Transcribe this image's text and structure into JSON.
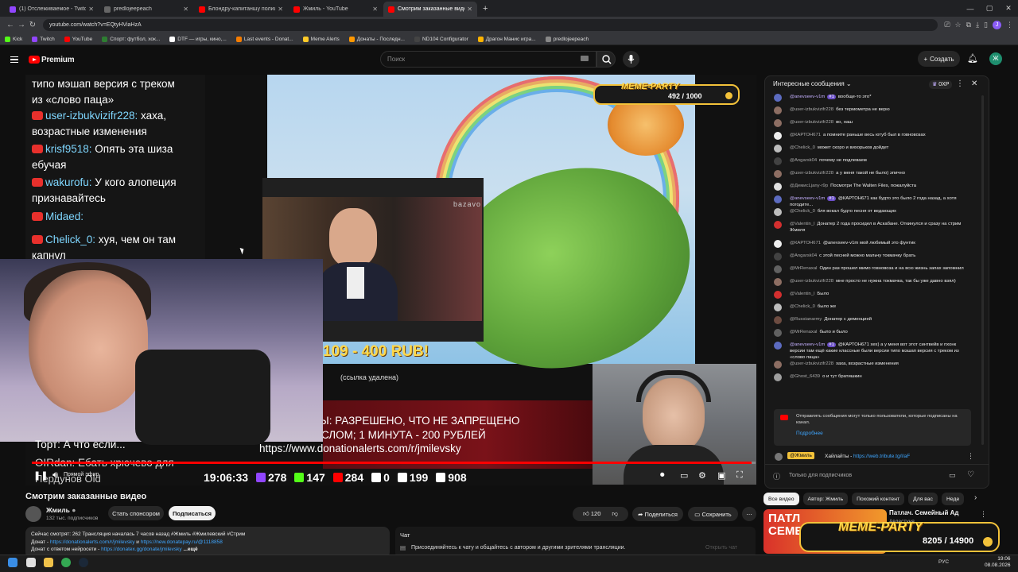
{
  "browser": {
    "tabs": [
      {
        "title": "(1) Отслеживаемое - Twitch",
        "color": "#9146ff"
      },
      {
        "title": "predlojeepeach",
        "color": "#666666"
      },
      {
        "title": "Блондру-капитаншу полиции",
        "color": "#ff0000"
      },
      {
        "title": "Жмиль - YouTube",
        "color": "#ff0000"
      },
      {
        "title": "Смотрим заказанные видео",
        "color": "#ff0000"
      }
    ],
    "address": "youtube.com/watch?v=EQtyHViaHzA",
    "bookmarks": [
      {
        "label": "Kick",
        "color": "#53fc18"
      },
      {
        "label": "Twitch",
        "color": "#9146ff"
      },
      {
        "label": "YouTube",
        "color": "#ff0000"
      },
      {
        "label": "Спорт: футбол, хок...",
        "color": "#2e7d32"
      },
      {
        "label": "DTF — игры, кино,...",
        "color": "#ffffff"
      },
      {
        "label": "Last events - Donat...",
        "color": "#f57c00"
      },
      {
        "label": "Meme Alerts",
        "color": "#ffca28"
      },
      {
        "label": "Донаты - Последн...",
        "color": "#ff9800"
      },
      {
        "label": "ND104 Configurator",
        "color": "#444444"
      },
      {
        "label": "Драгон Манис игра...",
        "color": "#ffb300"
      },
      {
        "label": "predlojeepeach",
        "color": "#888888"
      }
    ],
    "profile_letter": "J"
  },
  "youtube": {
    "logo_text": "Premium",
    "search_placeholder": "Поиск",
    "create_label": "Создать",
    "avatar_letter": "Ж"
  },
  "video": {
    "left_chat": [
      {
        "user": "",
        "text": "типо мэшап версия с треком"
      },
      {
        "user": "",
        "text": "из «слово паца»"
      },
      {
        "user": "user-izbukvizifr228:",
        "text": " хаха,"
      },
      {
        "user": "",
        "text": "возрастные изменения"
      },
      {
        "user": "krisf9518:",
        "text": " Опять эта шиза"
      },
      {
        "user": "",
        "text": "ебучая"
      },
      {
        "user": "wakurofu:",
        "text": " У кого алопеция"
      },
      {
        "user": "",
        "text": "признавайтесь"
      },
      {
        "user": "Midaed:",
        "text": ""
      },
      {
        "user": "Chelick_0:",
        "text": " хуя, чем он там"
      },
      {
        "user": "",
        "text": "капнул"
      }
    ],
    "meme_party": {
      "title": "MEME-PARTY",
      "value": "492 / 1000"
    },
    "bazavo": "bazavo",
    "price": "109 - 400 RUB!",
    "link_removed": "(ссылка удалена)",
    "ticker_1": "СЫ: РАЗРЕШЕНО, ЧТО НЕ ЗАПРЕЩЕНО",
    "ticker_2": "ЫСЛОМ; 1 МИНУТА - 200 РУБЛЕЙ",
    "ticker_3": "https://www.donationalerts.com/r/jmilevsky",
    "lower_chat_1": "Торт: А что если...",
    "lower_chat_2": "OIRdan: Ебать хрючево для",
    "lower_chat_3": "Пердунов Old",
    "time": "19:06:33",
    "stats": [
      {
        "value": "278",
        "color": "#9146ff"
      },
      {
        "value": "147",
        "color": "#53fc18"
      },
      {
        "value": "284",
        "color": "#ff0000"
      },
      {
        "value": "0",
        "color": "#ffffff"
      },
      {
        "value": "199",
        "color": "#ffffff"
      },
      {
        "value": "908",
        "color": "#ffffff"
      }
    ],
    "live_label": "Прямой эфир",
    "progress": 0.995
  },
  "meta": {
    "title": "Смотрим заказанные видео",
    "channel": "Жмиль",
    "subscribers": "132 тыс. подписчиков",
    "sponsor_label": "Стать спонсором",
    "subscribe_label": "Подписаться",
    "likes": "120",
    "share_label": "Поделиться",
    "save_label": "Сохранить",
    "desc_line1": "Сейчас смотрят: 262  Трансляция началась 7 часов назад  #Жмиль #Жмилевский #Стрим",
    "desc_line2_prefix": "Донат - ",
    "desc_link1": "https://donationalerts.com/r/jmilevsky",
    "desc_and": " и ",
    "desc_link2": "https://new.donatepay.ru/@1118858",
    "desc_line3_prefix": "Донат с ответом нейросети - ",
    "desc_link3": "https://donatex.gg/donate/jmilevsky",
    "desc_more": "...ещё",
    "chat_label": "Чат",
    "chat_join": "Присоединяйтесь к чату и общайтесь с автором и другими зрителями трансляции.",
    "chat_open": "Открыть чат"
  },
  "live_chat": {
    "title": "Интересные сообщения",
    "xp": "0XP",
    "messages": [
      {
        "user": "@anevseev-v1m",
        "badge": "#1",
        "text": "вообще-то это*",
        "color": "#5c6bc0"
      },
      {
        "user": "@user-izbukvizifr228",
        "text": "без термометра не верю",
        "color": "#8d6e63"
      },
      {
        "user": "@user-izbukvizifr228",
        "text": "во, наш",
        "color": "#8d6e63"
      },
      {
        "user": "@КАРТОН671",
        "text": "а помните раньше весь ютуб был в говновозах",
        "color": "#eeeeee"
      },
      {
        "user": "@Chelick_0",
        "text": "может скоро и вихорьков дойдет",
        "color": "#bdbdbd"
      },
      {
        "user": "@Angarsk04",
        "text": "почему не подлеваем",
        "color": "#424242"
      },
      {
        "user": "@user-izbukvizifr228",
        "text": "а у меня такой не было) эпично",
        "color": "#8d6e63"
      },
      {
        "user": "@ДемисLjany-r9p",
        "text": "Посмотри The Walten Files, пожалуйста",
        "color": "#e0e0e0"
      },
      {
        "user": "@anevseev-v1m",
        "badge": "#1",
        "text": "@КАРТОН671 как будто это было 2 года назад, а хотя погодите...",
        "color": "#5c6bc0"
      },
      {
        "user": "@Chelick_0",
        "text": "бля вокал будто песня от ведающих",
        "color": "#bdbdbd"
      },
      {
        "user": "@Valentin_l",
        "text": "Донатер 2 года просидел в Аскабане. Откинулся и сразу на стрим Жмиля",
        "color": "#d32f2f"
      },
      {
        "user": "@КАРТОН671",
        "text": "@anevseev-v1m мой любимый это фунтик",
        "color": "#eeeeee"
      },
      {
        "user": "@Angarsk04",
        "text": "с этой песней можно мальчу токмачку брать",
        "color": "#424242"
      },
      {
        "user": "@MrRenaxal",
        "text": "Один раз прошел мимо говновоза и на всю жизнь запах запомнил",
        "color": "#616161"
      },
      {
        "user": "@user-izbukvizifr228",
        "text": "мне просто не нужна токмачка, так бы уже давно взял)",
        "color": "#8d6e63"
      },
      {
        "user": "@Valentin_l",
        "text": "Было",
        "color": "#d32f2f"
      },
      {
        "user": "@Chelick_0",
        "text": "было же",
        "color": "#bdbdbd"
      },
      {
        "user": "@Russianarmy",
        "text": "Донатер с деменцией",
        "color": "#6d4c41"
      },
      {
        "user": "@MrRenaxal",
        "text": "было и было",
        "color": "#616161"
      },
      {
        "user": "@anevseev-v1m",
        "badge": "#1",
        "text": "@КАРТОН671 хех) а у меня вот этот синтвейв и пхонк версии там ещё какие классные были версии типо мэшап версия с треком из «слово паца»",
        "color": "#5c6bc0"
      },
      {
        "user": "@user-izbukvizifr228",
        "text": "хаха, возрастные изменения",
        "color": "#8d6e63"
      },
      {
        "user": "@Ghost_6439",
        "text": "о и тут братишкин",
        "color": "#9e9e9e"
      }
    ],
    "info_text": "Отправлять сообщения могут только пользователи, которые подписаны на канал.",
    "info_link": "Подробнее",
    "pinned_user": "@Жмиль",
    "pinned_text": "Хайлайты - ",
    "pinned_link": "https://web.tribute.tg/l/aF",
    "sub_only": "Только для подписчиков"
  },
  "recommend": {
    "chips": [
      "Все видео",
      "Автор: Жмиль",
      "Похожий контент",
      "Для вас",
      "Неде"
    ],
    "video_title": "Патлач. Семейный Ад",
    "video_author": "Авдестуня",
    "thumb_text": "ПАТЛ СЕМЕ",
    "meme_party_title": "MEME-PARTY",
    "meme_party_value": "8205 / 14900"
  },
  "taskbar": {
    "lang": "РУС",
    "time": "19:06",
    "date": "08.08.2026"
  }
}
